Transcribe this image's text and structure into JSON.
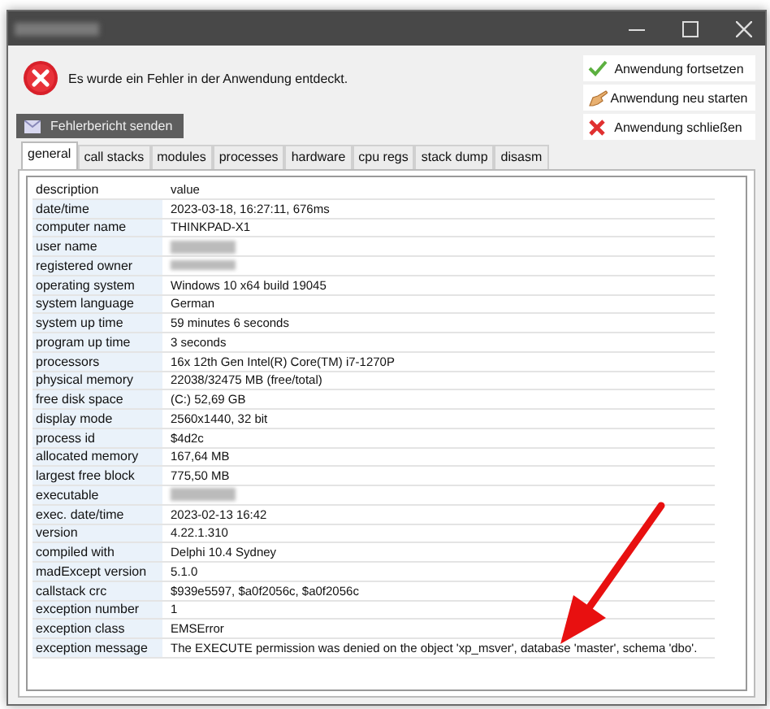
{
  "window": {
    "title_redacted": true
  },
  "message": "Es wurde ein Fehler in der Anwendung entdeckt.",
  "actions": [
    {
      "kind": "continue",
      "label": "Anwendung fortsetzen"
    },
    {
      "kind": "restart",
      "label": "Anwendung neu starten"
    },
    {
      "kind": "close",
      "label": "Anwendung schließen"
    }
  ],
  "send_button": "Fehlerbericht senden",
  "tabs": [
    {
      "label": "general",
      "selected": true
    },
    {
      "label": "call stacks",
      "selected": false
    },
    {
      "label": "modules",
      "selected": false
    },
    {
      "label": "processes",
      "selected": false
    },
    {
      "label": "hardware",
      "selected": false
    },
    {
      "label": "cpu regs",
      "selected": false
    },
    {
      "label": "stack dump",
      "selected": false
    },
    {
      "label": "disasm",
      "selected": false
    }
  ],
  "table": {
    "columns": [
      "description",
      "value"
    ],
    "rows": [
      {
        "label": "date/time",
        "value": "2023-03-18, 16:27:11, 676ms"
      },
      {
        "label": "computer name",
        "value": "THINKPAD-X1"
      },
      {
        "label": "user name",
        "redacted": true
      },
      {
        "label": "registered owner",
        "redacted": true
      },
      {
        "label": "operating system",
        "value": "Windows 10 x64 build 19045"
      },
      {
        "label": "system language",
        "value": "German"
      },
      {
        "label": "system up time",
        "value": "59 minutes 6 seconds"
      },
      {
        "label": "program up time",
        "value": "3 seconds"
      },
      {
        "label": "processors",
        "value": "16x 12th Gen Intel(R) Core(TM) i7-1270P"
      },
      {
        "label": "physical memory",
        "value": "22038/32475 MB (free/total)"
      },
      {
        "label": "free disk space",
        "value": "(C:) 52,69 GB"
      },
      {
        "label": "display mode",
        "value": "2560x1440, 32 bit"
      },
      {
        "label": "process id",
        "value": "$4d2c"
      },
      {
        "label": "allocated memory",
        "value": "167,64 MB"
      },
      {
        "label": "largest free block",
        "value": "775,50 MB"
      },
      {
        "label": "executable",
        "redacted": true
      },
      {
        "label": "exec. date/time",
        "value": "2023-02-13 16:42"
      },
      {
        "label": "version",
        "value": "4.22.1.310"
      },
      {
        "label": "compiled with",
        "value": "Delphi 10.4 Sydney"
      },
      {
        "label": "madExcept version",
        "value": "5.1.0"
      },
      {
        "label": "callstack crc",
        "value": "$939e5597, $a0f2056c, $a0f2056c"
      },
      {
        "label": "exception number",
        "value": "1"
      },
      {
        "label": "exception class",
        "value": "EMSError"
      },
      {
        "label": "exception message",
        "value": "The EXECUTE permission was denied on the object 'xp_msver', database 'master', schema 'dbo'."
      }
    ]
  }
}
